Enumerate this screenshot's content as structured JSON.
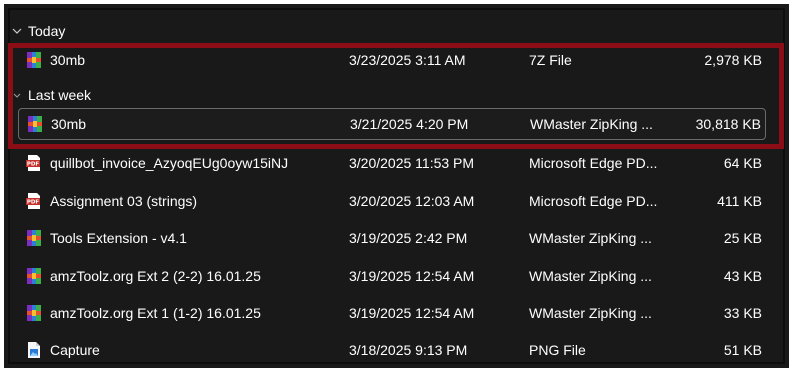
{
  "groups": {
    "today": {
      "label": "Today"
    },
    "last_week": {
      "label": "Last week"
    }
  },
  "rows": [
    {
      "name": "30mb",
      "date": "3/23/2025 3:11 AM",
      "type": "7Z File",
      "size": "2,978 KB",
      "icon": "archive-icon"
    },
    {
      "name": "30mb",
      "date": "3/21/2025 4:20 PM",
      "type": "WMaster ZipKing ...",
      "size": "30,818 KB",
      "icon": "archive-icon"
    },
    {
      "name": "quillbot_invoice_AzyoqEUg0oyw15iNJ",
      "date": "3/20/2025 11:53 PM",
      "type": "Microsoft Edge PD...",
      "size": "64 KB",
      "icon": "pdf-icon"
    },
    {
      "name": "Assignment 03 (strings)",
      "date": "3/20/2025 12:03 AM",
      "type": "Microsoft Edge PD...",
      "size": "411 KB",
      "icon": "pdf-icon"
    },
    {
      "name": "Tools Extension - v4.1",
      "date": "3/19/2025 2:42 PM",
      "type": "WMaster ZipKing ...",
      "size": "25 KB",
      "icon": "archive-icon"
    },
    {
      "name": "amzToolz.org Ext 2 (2-2) 16.01.25",
      "date": "3/19/2025 12:54 AM",
      "type": "WMaster ZipKing ...",
      "size": "43 KB",
      "icon": "archive-icon"
    },
    {
      "name": "amzToolz.org Ext 1 (1-2) 16.01.25",
      "date": "3/19/2025 12:54 AM",
      "type": "WMaster ZipKing ...",
      "size": "33 KB",
      "icon": "archive-icon"
    },
    {
      "name": "Capture",
      "date": "3/18/2025 9:13 PM",
      "type": "PNG File",
      "size": "51 KB",
      "icon": "image-file-icon"
    }
  ],
  "colors": {
    "background": "#191919",
    "highlight": "#8b0d16",
    "text": "#ffffff"
  }
}
